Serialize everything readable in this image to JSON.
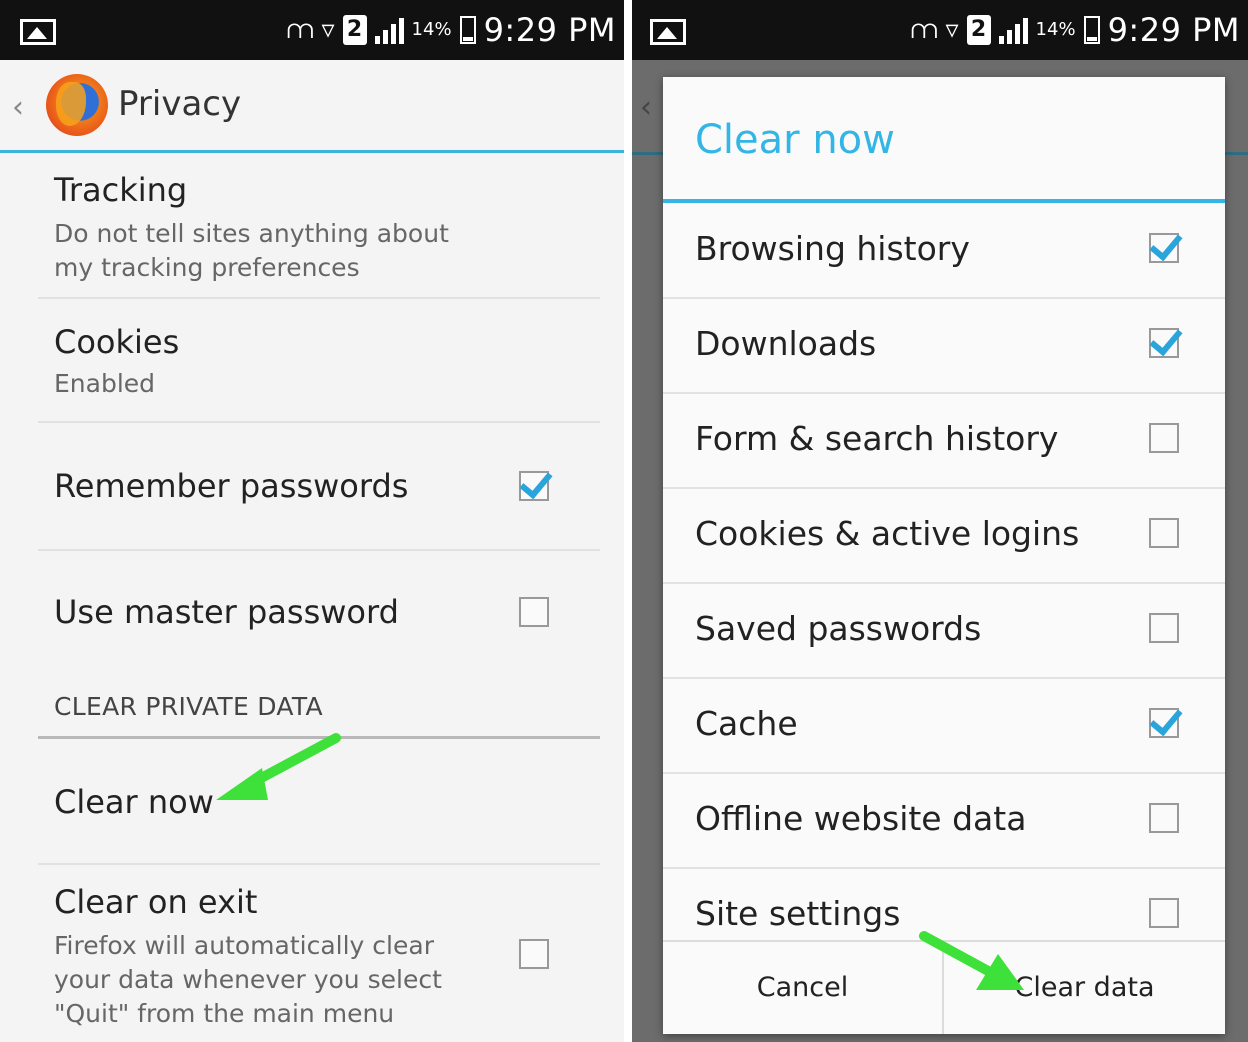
{
  "status_bar": {
    "time": "9:29 PM",
    "battery_pct": "14%",
    "sim": "2",
    "icons": [
      "image-icon",
      "nfc-icon",
      "wifi-icon",
      "sim-2-icon",
      "signal-icon",
      "battery-icon"
    ]
  },
  "privacy_screen": {
    "title": "Privacy",
    "prefs": {
      "tracking": {
        "title": "Tracking",
        "summary": "Do not tell sites anything about my tracking preferences"
      },
      "cookies": {
        "title": "Cookies",
        "summary": "Enabled"
      },
      "remember_passwords": {
        "title": "Remember passwords",
        "checked": true
      },
      "master_password": {
        "title": "Use master password",
        "checked": false
      }
    },
    "section_header": "CLEAR PRIVATE DATA",
    "clear_now": {
      "title": "Clear now"
    },
    "clear_on_exit": {
      "title": "Clear on exit",
      "summary": "Firefox will automatically clear your data whenever you select \"Quit\" from the main menu",
      "checked": false
    }
  },
  "clear_dialog": {
    "title": "Clear now",
    "options": [
      {
        "label": "Browsing history",
        "checked": true
      },
      {
        "label": "Downloads",
        "checked": true
      },
      {
        "label": "Form & search history",
        "checked": false
      },
      {
        "label": "Cookies & active logins",
        "checked": false
      },
      {
        "label": "Saved passwords",
        "checked": false
      },
      {
        "label": "Cache",
        "checked": true
      },
      {
        "label": "Offline website data",
        "checked": false
      },
      {
        "label": "Site settings",
        "checked": false
      }
    ],
    "cancel_label": "Cancel",
    "clear_label": "Clear data"
  },
  "colors": {
    "accent": "#33b5e5",
    "arrow": "#3ee03a",
    "checkmark": "#2aa5dc"
  }
}
